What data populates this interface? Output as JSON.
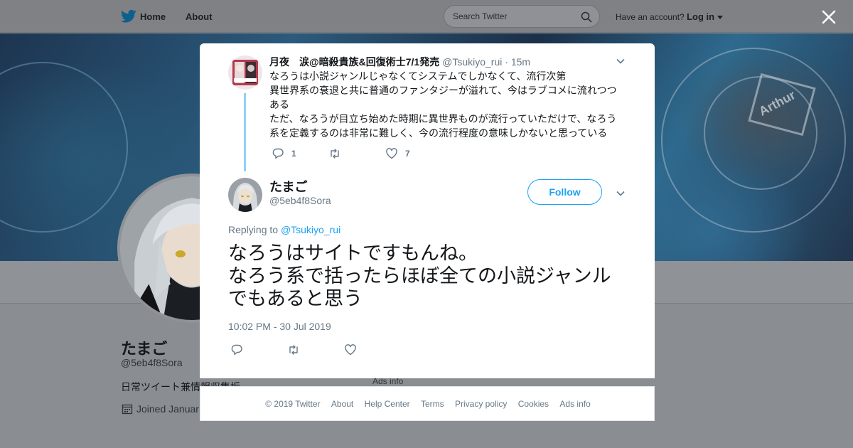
{
  "topbar": {
    "home_label": "Home",
    "about_label": "About",
    "search_placeholder": "Search Twitter",
    "account_prompt": "Have an account?",
    "login_label": "Log in"
  },
  "banner": {
    "hex_label": "Arthur"
  },
  "profile": {
    "name": "たまご",
    "handle": "@5eb4f8Sora",
    "bio": "日常ツイート兼情報収集垢",
    "joined": "Joined Januar",
    "ads_info": "Ads info"
  },
  "parent_tweet": {
    "author_name": "月夜　涙@暗殺貴族&回復術士7/1発売",
    "author_handle": "@Tsukiyo_rui",
    "time_ago": "· 15m",
    "text_lines": [
      "なろうは小説ジャンルじゃなくてシステムでしかなくて、流行次第",
      "異世界系の衰退と共に普通のファンタジーが溢れて、今はラブコメに流れつつある",
      "ただ、なろうが目立ち始めた時期に異世界ものが流行っていただけで、なろう系を定義するのは非常に難しく、今の流行程度の意味しかないと思っている"
    ],
    "reply_count": "1",
    "retweet_count": "",
    "like_count": "7"
  },
  "main_tweet": {
    "author_name": "たまご",
    "author_handle": "@5eb4f8Sora",
    "follow_label": "Follow",
    "replying_prefix": "Replying to",
    "replying_handle": "@Tsukiyo_rui",
    "text_lines": [
      "なろうはサイトですもんね。",
      "なろう系で括ったらほぼ全ての小説ジャンルでもあると思う"
    ],
    "timestamp": "10:02 PM - 30 Jul 2019"
  },
  "footer": {
    "links": [
      "© 2019 Twitter",
      "About",
      "Help Center",
      "Terms",
      "Privacy policy",
      "Cookies",
      "Ads info"
    ]
  },
  "colors": {
    "accent": "#1da1f2",
    "thread_line": "#8fd1f6",
    "muted_text": "#657786"
  },
  "icons": {
    "logo": "twitter-bird-icon",
    "search": "search-icon",
    "close": "close-icon",
    "caret": "caret-down-icon",
    "reply": "reply-icon",
    "retweet": "retweet-icon",
    "like": "heart-icon",
    "calendar": "calendar-icon",
    "more": "chevron-down-icon"
  }
}
